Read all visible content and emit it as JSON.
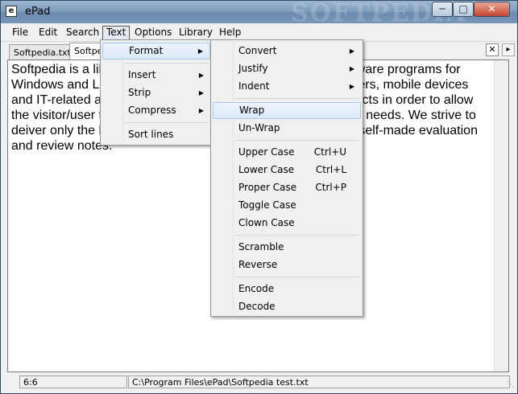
{
  "window": {
    "title": "ePad",
    "watermark": "SOFTPEDIA"
  },
  "menubar": {
    "items": [
      "File",
      "Edit",
      "Search",
      "Text",
      "Options",
      "Library",
      "Help"
    ]
  },
  "tabs": [
    {
      "label": "Softpedia.txt"
    },
    {
      "label": "Softpe"
    }
  ],
  "editor": {
    "text": "Softpedia is a library of over 400,000 free and free-to-try software programs for Windows and Linux, games and Mac software, Windows drivers, mobile devices and IT-related articles. We review and categorize these products in order to allow the visitor/user to find the exact product they and their system needs. We strive to deiver only the best products to the visitor/user together with self-made evaluation and review notes."
  },
  "text_menu": {
    "items": [
      {
        "label": "Format",
        "submenu": true
      },
      {
        "label": "Insert",
        "submenu": true
      },
      {
        "label": "Strip",
        "submenu": true
      },
      {
        "label": "Compress",
        "submenu": true
      },
      {
        "label": "Sort lines",
        "submenu": false
      }
    ]
  },
  "format_menu": {
    "items": [
      {
        "label": "Convert",
        "submenu": true
      },
      {
        "label": "Justify",
        "submenu": true
      },
      {
        "label": "Indent",
        "submenu": true
      },
      {
        "label": "Wrap",
        "shortcut": ""
      },
      {
        "label": "Un-Wrap",
        "shortcut": ""
      },
      {
        "label": "Upper Case",
        "shortcut": "Ctrl+U"
      },
      {
        "label": "Lower Case",
        "shortcut": "Ctrl+L"
      },
      {
        "label": "Proper Case",
        "shortcut": "Ctrl+P"
      },
      {
        "label": "Toggle Case",
        "shortcut": ""
      },
      {
        "label": "Clown Case",
        "shortcut": ""
      },
      {
        "label": "Scramble",
        "shortcut": ""
      },
      {
        "label": "Reverse",
        "shortcut": ""
      },
      {
        "label": "Encode",
        "shortcut": ""
      },
      {
        "label": "Decode",
        "shortcut": ""
      }
    ]
  },
  "statusbar": {
    "position": "6:6",
    "path": "C:\\Program Files\\ePad\\Softpedia test.txt"
  },
  "icons": {
    "app": "app-icon",
    "close": "close-icon",
    "min": "minimize-icon",
    "max": "maximize-icon",
    "arrow": "chevron-right-icon"
  }
}
